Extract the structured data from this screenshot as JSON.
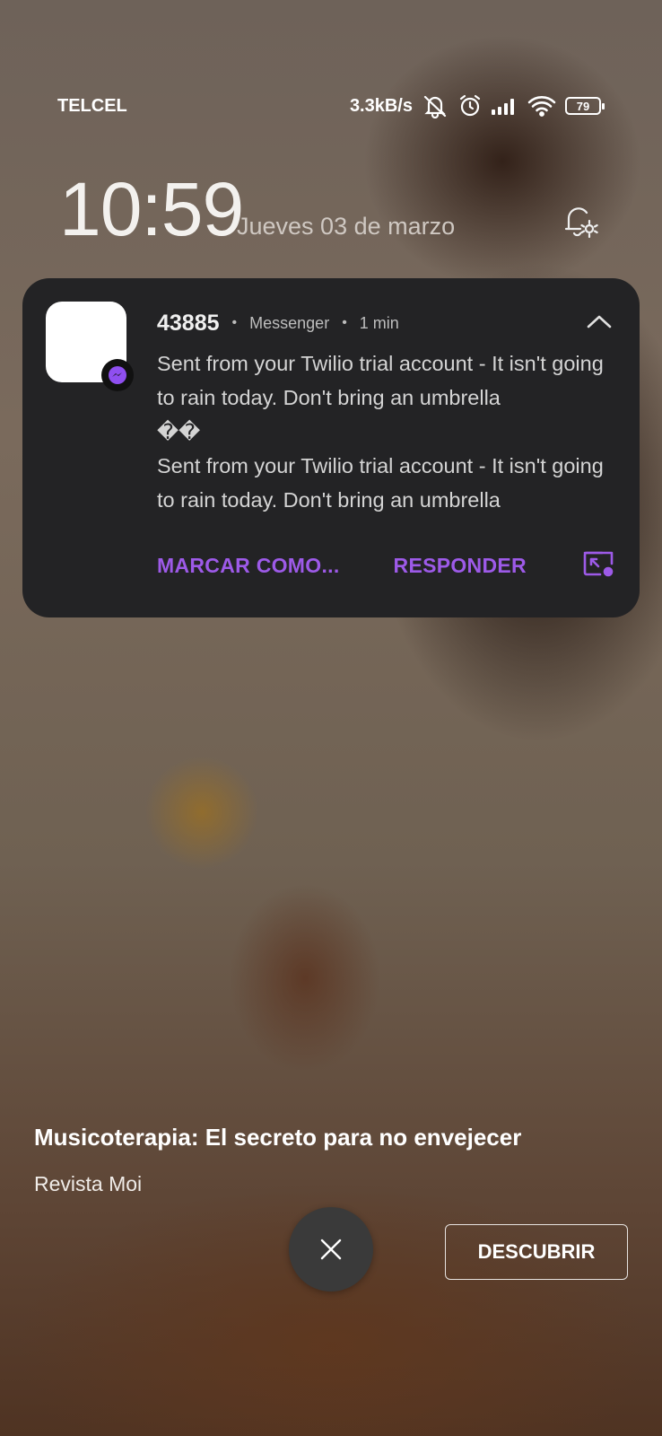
{
  "status_bar": {
    "carrier": "TELCEL",
    "net_speed": "3.3kB/s",
    "battery": "79",
    "icons": [
      "bell-off-icon",
      "alarm-icon",
      "signal-icon",
      "wifi-icon",
      "battery-icon"
    ]
  },
  "lockscreen": {
    "time": "10:59",
    "date": "Jueves 03 de marzo"
  },
  "notification": {
    "sender": "43885",
    "app": "Messenger",
    "time_ago": "1 min",
    "messages": [
      "Sent from your Twilio trial account - It isn't going to rain today. Don't bring an umbrella",
      "��",
      "Sent from your Twilio trial account - It isn't going to rain today. Don't bring an umbrella"
    ],
    "actions": {
      "mark_as": "MARCAR COMO...",
      "reply": "RESPONDER"
    },
    "accent_color": "#9d5ae8"
  },
  "article": {
    "title": "Musicoterapia: El secreto para no envejecer",
    "source": "Revista Moi",
    "discover_label": "DESCUBRIR"
  }
}
